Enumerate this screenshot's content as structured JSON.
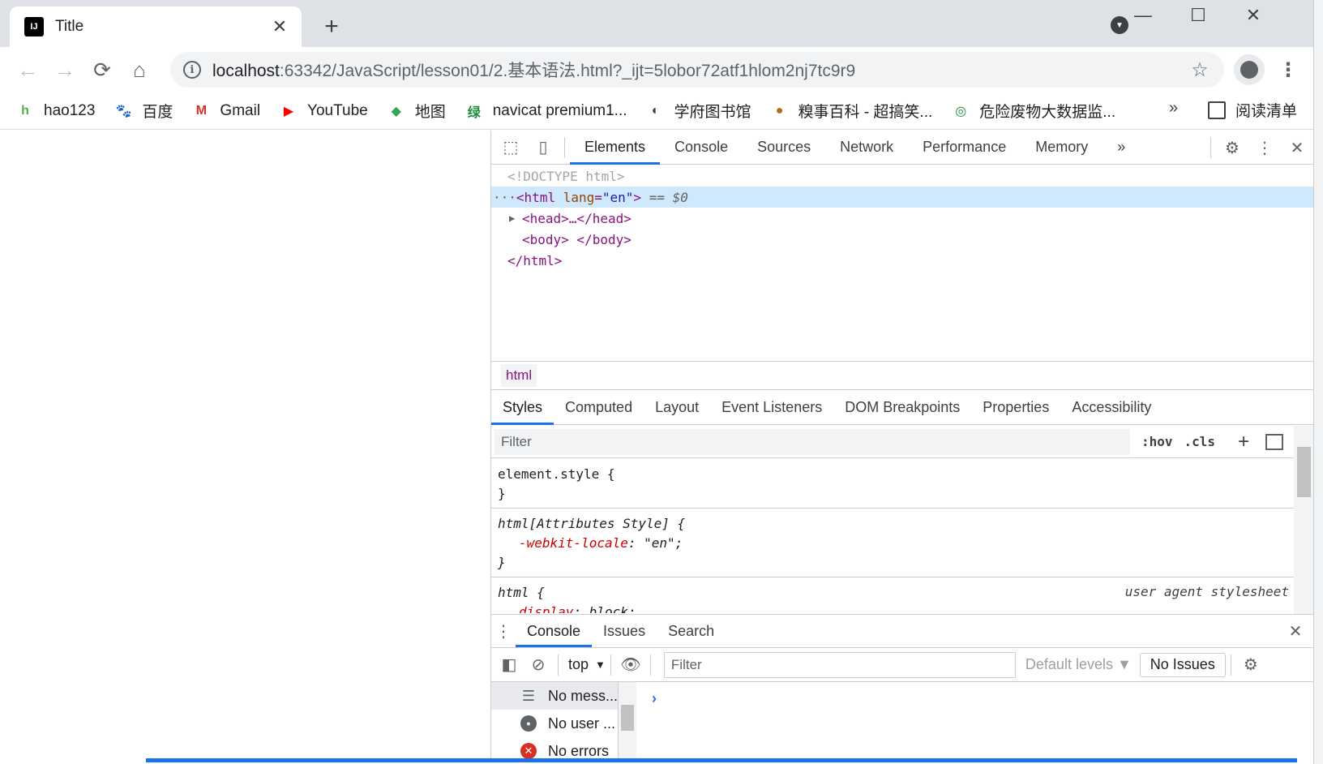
{
  "browser": {
    "tab": {
      "title": "Title",
      "favicon": "intellij-icon",
      "close": "✕"
    },
    "new_tab": "+",
    "window_controls": {
      "minimize": "—",
      "maximize": "☐",
      "close": "✕"
    },
    "nav": {
      "back": "←",
      "forward": "→",
      "reload": "⟳",
      "home": "⌂"
    },
    "url_host": "localhost",
    "url_rest": ":63342/JavaScript/lesson01/2.基本语法.html?_ijt=5lobor72atf1hlom2nj7tc9r9",
    "bookmarks": [
      {
        "label": "hao123",
        "icon": "hao123-icon",
        "color": "#4caf50",
        "glyph": "h"
      },
      {
        "label": "百度",
        "icon": "baidu-icon",
        "color": "#2932e1",
        "glyph": "🐾"
      },
      {
        "label": "Gmail",
        "icon": "gmail-icon",
        "color": "#d93025",
        "glyph": "M"
      },
      {
        "label": "YouTube",
        "icon": "youtube-icon",
        "color": "#ff0000",
        "glyph": "▶"
      },
      {
        "label": "地图",
        "icon": "maps-icon",
        "color": "#34a853",
        "glyph": "◆"
      },
      {
        "label": "navicat premium1...",
        "icon": "navicat-icon",
        "color": "#1e8e3e",
        "glyph": "绿"
      },
      {
        "label": "学府图书馆",
        "icon": "library-icon",
        "color": "#3c4043",
        "glyph": "◐"
      },
      {
        "label": "糗事百科 - 超搞笑...",
        "icon": "qiushi-icon",
        "color": "#b06d1f",
        "glyph": "●"
      },
      {
        "label": "危险废物大数据监...",
        "icon": "waste-icon",
        "color": "#1e8e3e",
        "glyph": "◎"
      }
    ],
    "bookmarks_more": "»",
    "reading_list": "阅读清单"
  },
  "devtools": {
    "main_tabs": [
      "Elements",
      "Console",
      "Sources",
      "Network",
      "Performance",
      "Memory"
    ],
    "more_tabs": "»",
    "elements": {
      "doctype": "<!DOCTYPE html>",
      "html_open_tag": "html",
      "html_lang_attr": "lang",
      "html_lang_val": "\"en\"",
      "selected_marker": "== $0",
      "head_line": "<head>…</head>",
      "body_line": "<body> </body>",
      "html_close": "</html>"
    },
    "breadcrumb": "html",
    "sub_tabs": [
      "Styles",
      "Computed",
      "Layout",
      "Event Listeners",
      "DOM Breakpoints",
      "Properties",
      "Accessibility"
    ],
    "styles": {
      "filter_placeholder": "Filter",
      "hov": ":hov",
      "cls": ".cls",
      "add": "+",
      "rule1_selector": "element.style {",
      "rule1_close": "}",
      "rule2_selector": "html[Attributes Style] {",
      "rule2_prop": "-webkit-locale",
      "rule2_val": "\"en\";",
      "rule2_close": "}",
      "rule3_selector": "html {",
      "rule3_source": "user agent stylesheet",
      "rule3_prop": "display",
      "rule3_val": "block;"
    },
    "drawer": {
      "tabs": [
        "Console",
        "Issues",
        "Search"
      ],
      "context": "top",
      "filter_placeholder": "Filter",
      "levels": "Default levels ▼",
      "issues": "No Issues",
      "sidebar": [
        {
          "label": "No mess...",
          "icon": "list-icon"
        },
        {
          "label": "No user ...",
          "icon": "user-icon"
        },
        {
          "label": "No errors",
          "icon": "error-icon"
        }
      ],
      "prompt": "›"
    }
  }
}
